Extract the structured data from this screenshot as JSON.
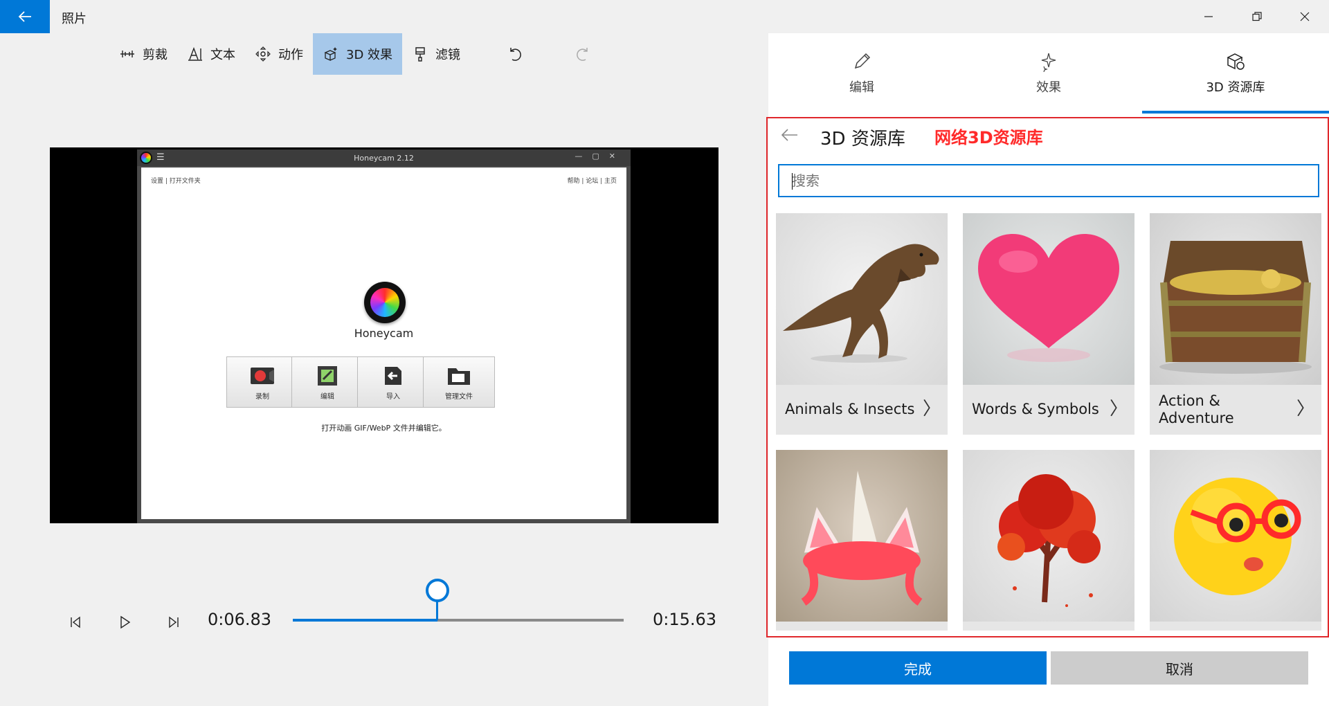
{
  "app": {
    "title": "照片"
  },
  "toolbar": {
    "crop": "剪裁",
    "text": "文本",
    "motion": "动作",
    "effects3d": "3D 效果",
    "filters": "滤镜"
  },
  "preview": {
    "honeycam": {
      "window_title": "Honeycam 2.12",
      "left_links": "设置 | 打开文件夹",
      "right_links": "帮助 | 论坛 | 主页",
      "app_name": "Honeycam",
      "buttons": [
        "录制",
        "编辑",
        "导入",
        "管理文件"
      ],
      "hint": "打开动画 GIF/WebP 文件并编辑它。"
    }
  },
  "playback": {
    "current_time": "0:06.83",
    "total_time": "0:15.63",
    "progress": 0.437
  },
  "panel": {
    "tabs": [
      {
        "label": "编辑",
        "icon": "pencil-icon"
      },
      {
        "label": "效果",
        "icon": "sparkle-icon"
      },
      {
        "label": "3D 资源库",
        "icon": "3d-cube-icon",
        "active": true
      }
    ],
    "library_title": "3D 资源库",
    "annotation": "网络3D资源库",
    "search_placeholder": "搜索",
    "categories": [
      {
        "label": "Animals & Insects"
      },
      {
        "label": "Words & Symbols"
      },
      {
        "label": "Action & Adventure"
      },
      {
        "label": ""
      },
      {
        "label": ""
      },
      {
        "label": ""
      }
    ],
    "done_label": "完成",
    "cancel_label": "取消"
  },
  "colors": {
    "accent": "#0078d7",
    "annotation_red": "#e0272b",
    "active_tool_bg": "#a6c8ea"
  }
}
